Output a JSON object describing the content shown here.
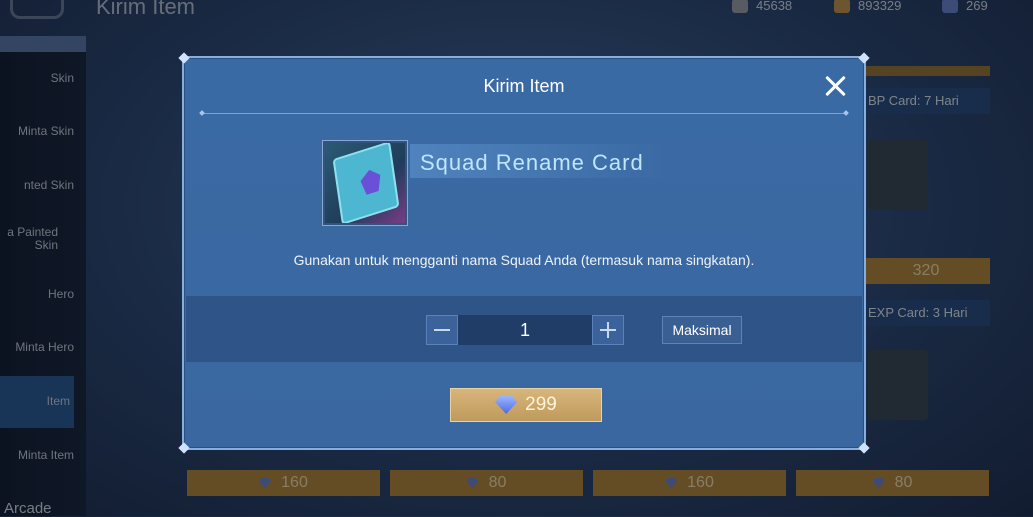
{
  "background": {
    "title": "Kirim Item",
    "currencies": [
      {
        "icon": "ticket-icon",
        "value": "45638",
        "color": "#a0a6b0"
      },
      {
        "icon": "battle-point-coin-icon",
        "value": "893329",
        "color": "#c59a56"
      },
      {
        "icon": "diamond-icon",
        "value": "269",
        "color": "#6e88d8"
      }
    ],
    "sidebar": [
      {
        "label": "Skin"
      },
      {
        "label": "Minta Skin"
      },
      {
        "label": "nted Skin"
      },
      {
        "label": "a Painted Skin"
      },
      {
        "label": "Hero"
      },
      {
        "label": "Minta Hero"
      },
      {
        "label": "Item"
      },
      {
        "label": "Minta Item"
      }
    ],
    "arcade_label": "Arcade",
    "cards": [
      {
        "label": "BP Card: 7 Hari",
        "price": "320"
      },
      {
        "label": "EXP Card: 3 Hari"
      }
    ],
    "bottom_prices": [
      "160",
      "80",
      "160",
      "80"
    ]
  },
  "dialog": {
    "title": "Kirim Item",
    "close_icon": "close-icon",
    "item": {
      "name": "Squad Rename Card",
      "icon": "rename-card-icon"
    },
    "description": "Gunakan untuk mengganti nama Squad Anda (termasuk nama singkatan).",
    "quantity": "1",
    "max_label": "Maksimal",
    "price": "299",
    "price_icon": "diamond-icon"
  }
}
